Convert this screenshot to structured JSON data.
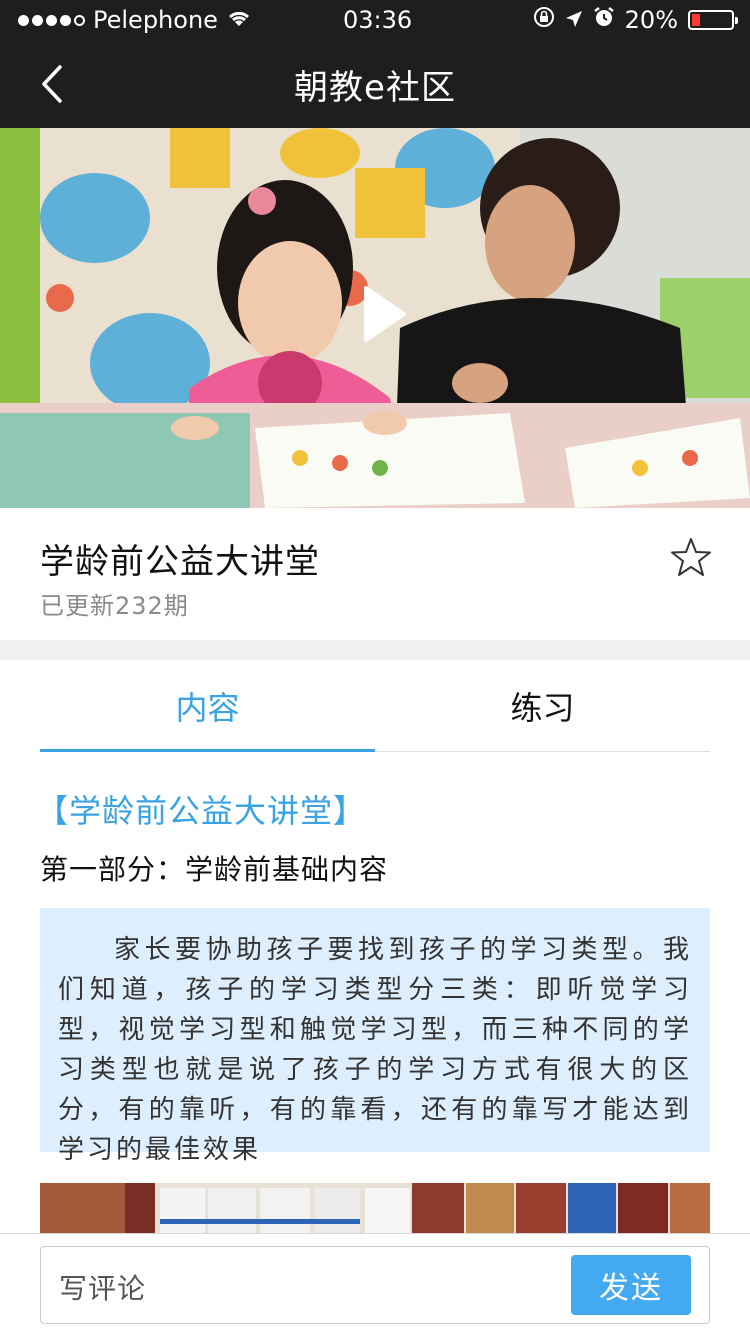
{
  "status_bar": {
    "carrier": "Pelephone",
    "time": "03:36",
    "battery_text": "20%",
    "battery_level": 0.2,
    "signal_bars_filled": 4,
    "signal_bars_total": 5
  },
  "nav": {
    "title": "朝教e社区",
    "back_icon": "chevron-left-icon"
  },
  "hero": {
    "play_icon": "play-icon"
  },
  "course": {
    "title": "学龄前公益大讲堂",
    "subtitle": "已更新232期",
    "favorite_icon": "star-outline-icon"
  },
  "tabs": [
    {
      "label": "内容",
      "active": true
    },
    {
      "label": "练习",
      "active": false
    }
  ],
  "content": {
    "heading": "【学龄前公益大讲堂】",
    "section": "第一部分：学龄前基础内容",
    "quote": "家长要协助孩子要找到孩子的学习类型。我们知道，孩子的学习类型分三类：即听觉学习型，视觉学习型和触觉学习型，而三种不同的学习类型也就是说了孩子的学习方式有很大的区分，有的靠听，有的靠看，还有的靠写才能达到学习的最佳效果"
  },
  "comment": {
    "placeholder": "写评论",
    "send_label": "发送"
  },
  "colors": {
    "accent": "#3aa3e3",
    "send_button": "#43a9f0",
    "header_bg": "#1e1e1e",
    "quote_bg": "#ddeefc"
  }
}
